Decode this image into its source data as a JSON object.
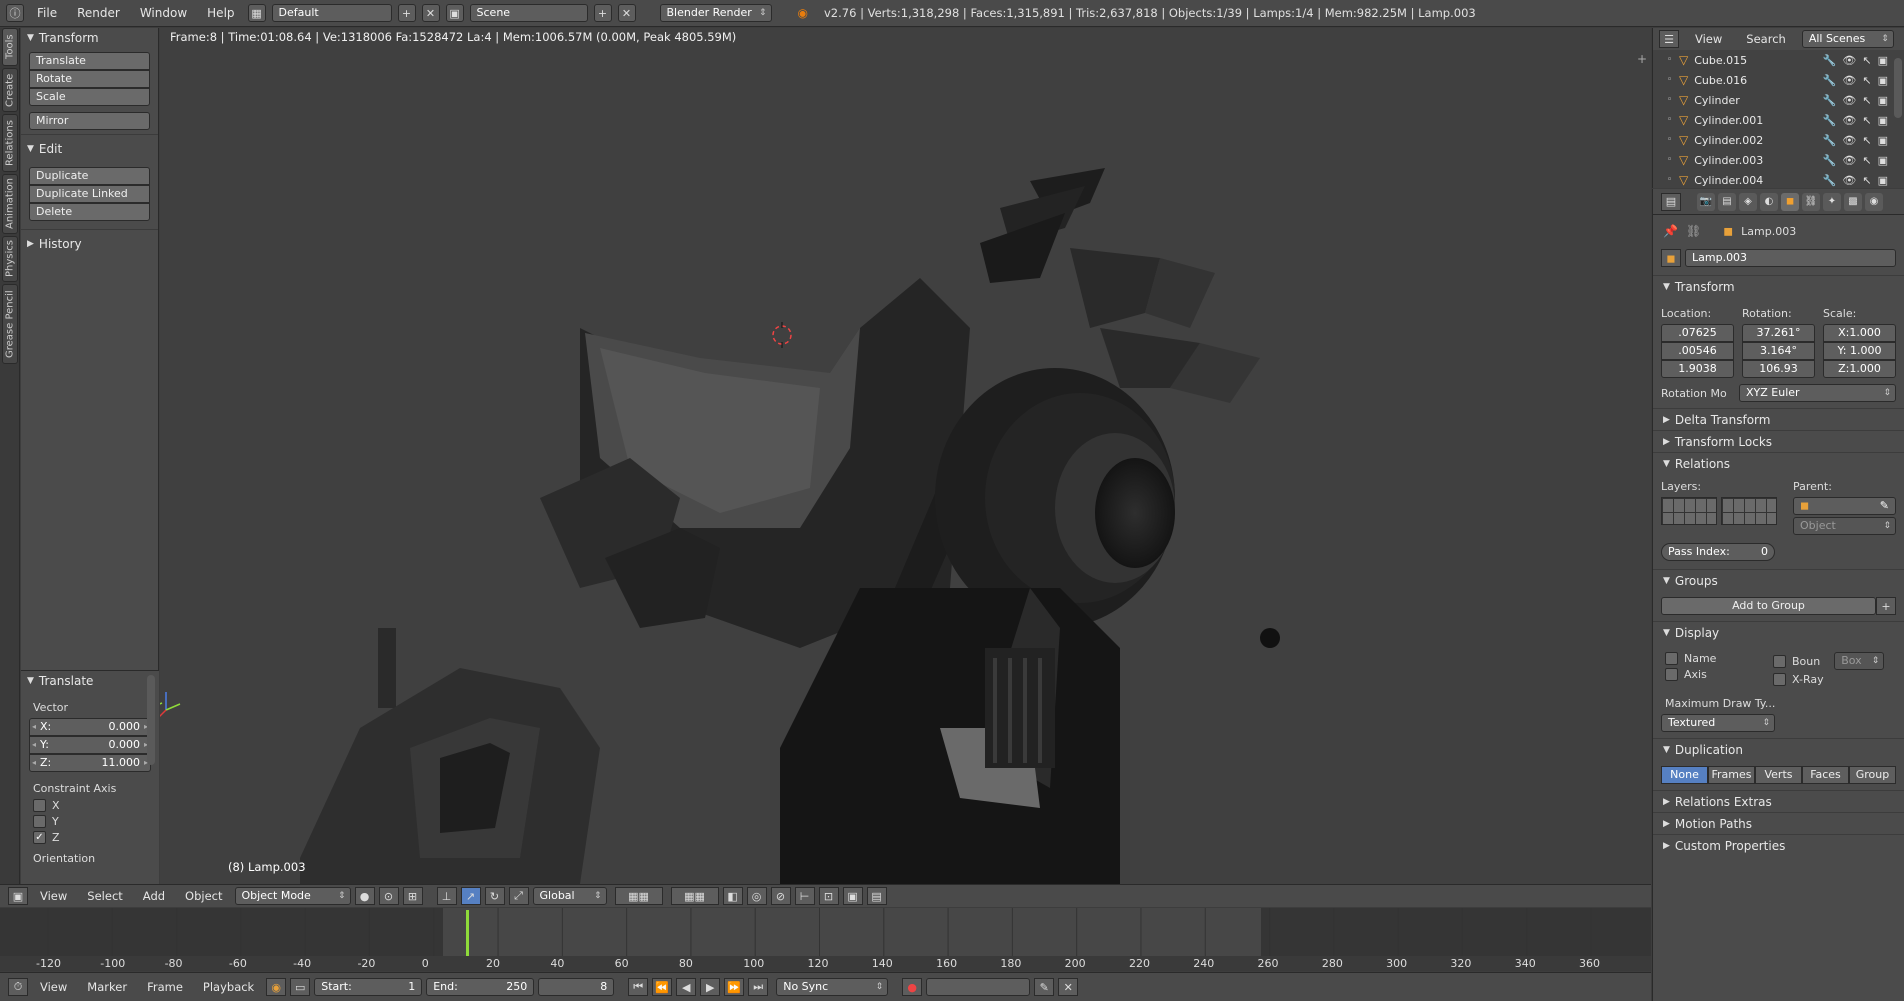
{
  "topbar": {
    "menus": [
      "File",
      "Render",
      "Window",
      "Help"
    ],
    "layout": "Default",
    "scene": "Scene",
    "engine": "Blender Render",
    "stats": "v2.76 | Verts:1,318,298 | Faces:1,315,891 | Tris:2,637,818 | Objects:1/39 | Lamps:1/4 | Mem:982.25M | Lamp.003"
  },
  "lefttabs": [
    "Tools",
    "Create",
    "Relations",
    "Animation",
    "Physics",
    "Grease Pencil"
  ],
  "toolshelf": {
    "transform_title": "Transform",
    "transform_buttons": [
      "Translate",
      "Rotate",
      "Scale"
    ],
    "mirror": "Mirror",
    "edit_title": "Edit",
    "edit_buttons": [
      "Duplicate",
      "Duplicate Linked",
      "Delete"
    ],
    "history_title": "History"
  },
  "operator": {
    "title": "Translate",
    "vector_label": "Vector",
    "x": "X:",
    "xv": "0.000",
    "y": "Y:",
    "yv": "0.000",
    "z": "Z:",
    "zv": "11.000",
    "constraint_label": "Constraint Axis",
    "ax": "X",
    "ay": "Y",
    "az": "Z",
    "orientation": "Orientation"
  },
  "viewport": {
    "info": "Frame:8 | Time:01:08.64 | Ve:1318006 Fa:1528472 La:4 | Mem:1006.57M (0.00M, Peak 4805.59M)",
    "object": "(8) Lamp.003"
  },
  "vpheader": {
    "menus": [
      "View",
      "Select",
      "Add",
      "Object"
    ],
    "mode": "Object Mode",
    "orient": "Global"
  },
  "timeline": {
    "ticks": [
      "-120",
      "-100",
      "-80",
      "-60",
      "-40",
      "-20",
      "0",
      "20",
      "40",
      "60",
      "80",
      "100",
      "120",
      "140",
      "160",
      "180",
      "200",
      "220",
      "240",
      "260",
      "280",
      "300",
      "320",
      "340",
      "360"
    ],
    "current": 8
  },
  "tlheader": {
    "menus": [
      "View",
      "Marker",
      "Frame",
      "Playback"
    ],
    "start_label": "Start:",
    "start": "1",
    "end_label": "End:",
    "end": "250",
    "frame": "8",
    "sync": "No Sync"
  },
  "outliner": {
    "view": "View",
    "search": "Search",
    "scenes": "All Scenes",
    "rows": [
      "Cube.015",
      "Cube.016",
      "Cylinder",
      "Cylinder.001",
      "Cylinder.002",
      "Cylinder.003",
      "Cylinder.004"
    ]
  },
  "props": {
    "breadcrumb": "Lamp.003",
    "name": "Lamp.003",
    "transform": "Transform",
    "loc_label": "Location:",
    "rot_label": "Rotation:",
    "scale_label": "Scale:",
    "loc": [
      ".07625",
      ".00546",
      "1.9038"
    ],
    "rot": [
      "37.261°",
      "3.164°",
      "106.93"
    ],
    "scale": [
      "X:1.000",
      "Y: 1.000",
      "Z:1.000"
    ],
    "rotmode_label": "Rotation Mo",
    "rotmode": "XYZ Euler",
    "delta": "Delta Transform",
    "locks": "Transform Locks",
    "relations": "Relations",
    "layers": "Layers:",
    "parent": "Parent:",
    "parent_type": "Object",
    "pass_label": "Pass Index:",
    "pass": "0",
    "groups": "Groups",
    "add_group": "Add to Group",
    "display": "Display",
    "name_chk": "Name",
    "bounds_chk": "Boun",
    "box": "Box",
    "axis_chk": "Axis",
    "xray_chk": "X-Ray",
    "maxdraw": "Maximum Draw Ty...",
    "textured": "Textured",
    "duplication": "Duplication",
    "dup": [
      "None",
      "Frames",
      "Verts",
      "Faces",
      "Group"
    ],
    "rel_extras": "Relations Extras",
    "motion": "Motion Paths",
    "custom": "Custom Properties"
  }
}
